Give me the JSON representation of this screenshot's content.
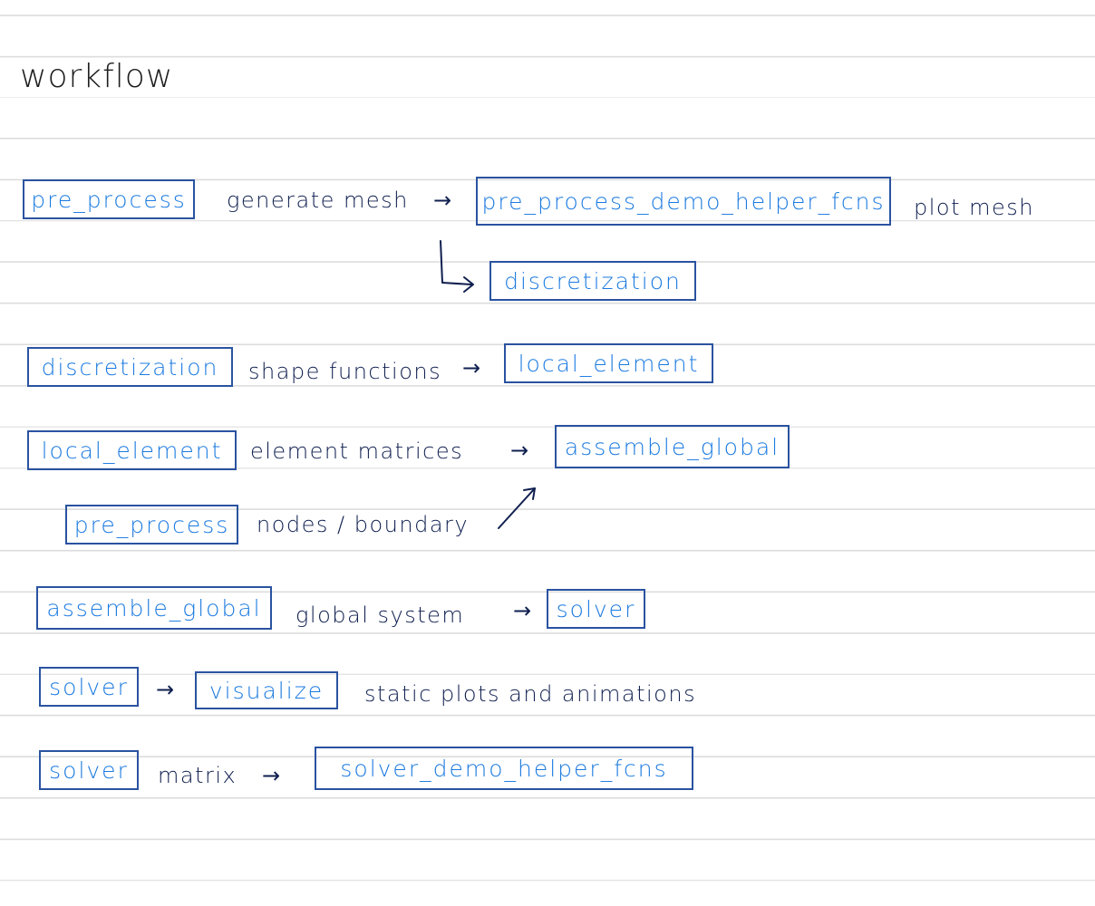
{
  "title": "workflow",
  "colors": {
    "box_border": "#2a53a0",
    "box_text": "#1b7ae0",
    "note_text": "#0f1f4f",
    "rule_line": "#dcdcdc"
  },
  "row1": {
    "source": "pre_process",
    "note": "generate mesh",
    "target": "pre_process_demo_helper_fcns",
    "after": "plot mesh",
    "branch_target": "discretization"
  },
  "row2": {
    "source": "discretization",
    "note": "shape functions",
    "target": "local_element"
  },
  "row3": {
    "source": "local_element",
    "note": "element matrices",
    "target": "assemble_global"
  },
  "row4": {
    "source": "pre_process",
    "note": "nodes / boundary"
  },
  "row5": {
    "source": "assemble_global",
    "note": "global system",
    "target": "solver"
  },
  "row6": {
    "source": "solver",
    "target": "visualize",
    "after": "static plots and animations"
  },
  "row7": {
    "source": "solver",
    "note": "matrix",
    "target": "solver_demo_helper_fcns"
  },
  "arrow_glyph": "→"
}
